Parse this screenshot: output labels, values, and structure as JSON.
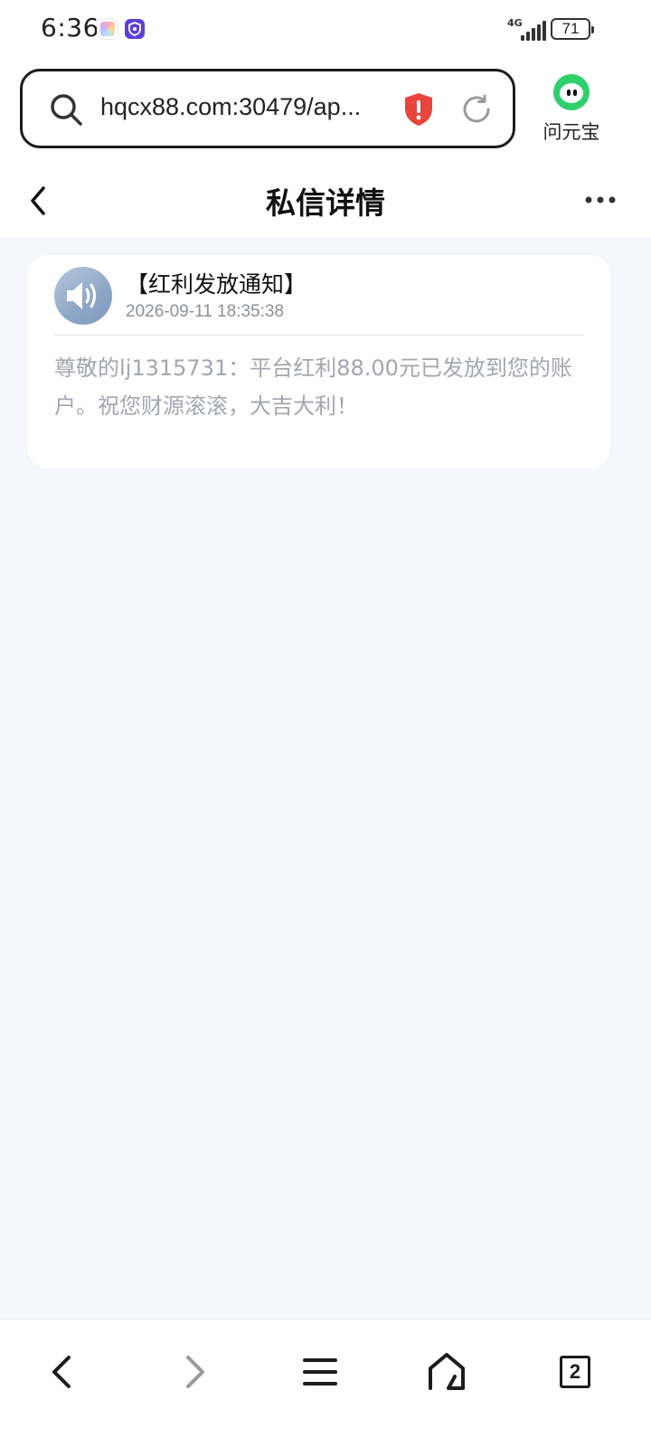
{
  "status_bar": {
    "time": "6:36",
    "network": "4G",
    "battery_level": "71"
  },
  "browser": {
    "url": "hqcx88.com:30479/ap...",
    "assistant_label": "问元宝",
    "colors": {
      "shield_warning": "#e8453c",
      "assistant_green": "#2fcf6c"
    }
  },
  "header": {
    "title": "私信详情"
  },
  "message": {
    "title": "【红利发放通知】",
    "time": "2026-09-11 18:35:38",
    "body": "尊敬的lj1315731：平台红利88.00元已发放到您的账户。祝您财源滚滚，大吉大利！"
  },
  "bottom_nav": {
    "tab_count": "2",
    "icons": [
      "back-icon",
      "forward-icon",
      "menu-icon",
      "home-icon",
      "tabs-icon"
    ]
  }
}
